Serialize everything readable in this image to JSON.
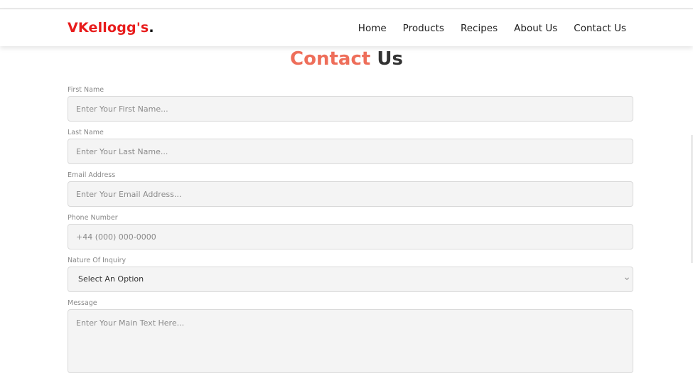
{
  "brand": {
    "name": "VKellogg's",
    "dot": "."
  },
  "nav": {
    "items": [
      {
        "label": "Home"
      },
      {
        "label": "Products"
      },
      {
        "label": "Recipes"
      },
      {
        "label": "About Us"
      },
      {
        "label": "Contact Us"
      }
    ]
  },
  "page": {
    "title_accent": "Contact",
    "title_rest": "Us"
  },
  "form": {
    "first_name": {
      "label": "First Name",
      "placeholder": "Enter Your First Name..."
    },
    "last_name": {
      "label": "Last Name",
      "placeholder": "Enter Your Last Name..."
    },
    "email": {
      "label": "Email Address",
      "placeholder": "Enter Your Email Address..."
    },
    "phone": {
      "label": "Phone Number",
      "placeholder": "+44 (000) 000-0000"
    },
    "inquiry": {
      "label": "Nature Of Inquiry",
      "selected": "Select An Option"
    },
    "message": {
      "label": "Message",
      "placeholder": "Enter Your Main Text Here..."
    }
  },
  "colors": {
    "brand": "#e81c1c",
    "title_accent": "#ee6e5a"
  }
}
